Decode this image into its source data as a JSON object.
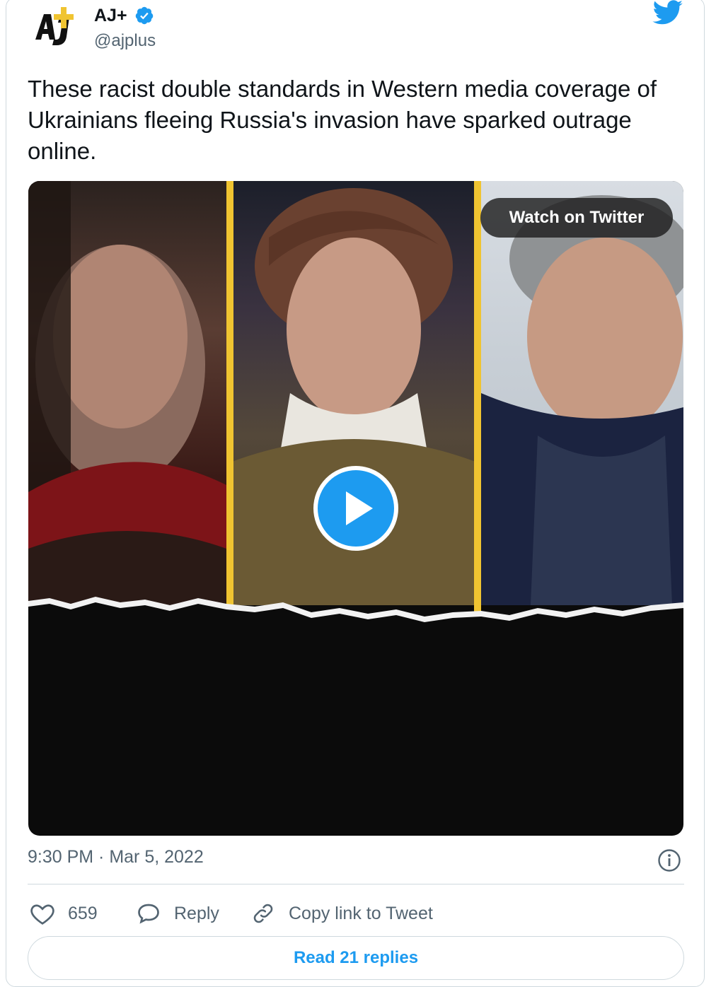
{
  "author": {
    "display_name": "AJ+",
    "handle": "@ajplus"
  },
  "tweet": {
    "text": "These racist double standards in Western media coverage of Ukrainians fleeing Russia's invasion have sparked outrage online.",
    "timestamp": "9:30 PM · Mar 5, 2022"
  },
  "media": {
    "watch_label": "Watch on Twitter",
    "play_icon": "play-icon"
  },
  "actions": {
    "likes": "659",
    "reply_label": "Reply",
    "copy_link_label": "Copy link to Tweet"
  },
  "read_replies_label": "Read 21 replies",
  "colors": {
    "accent": "#1d9bf0",
    "muted": "#536471",
    "border": "#cfd9de",
    "stripe": "#f0c431"
  },
  "icons": [
    "ajplus-logo-icon",
    "verified-badge-icon",
    "twitter-bird-icon",
    "info-icon",
    "heart-icon",
    "reply-bubble-icon",
    "link-icon"
  ]
}
